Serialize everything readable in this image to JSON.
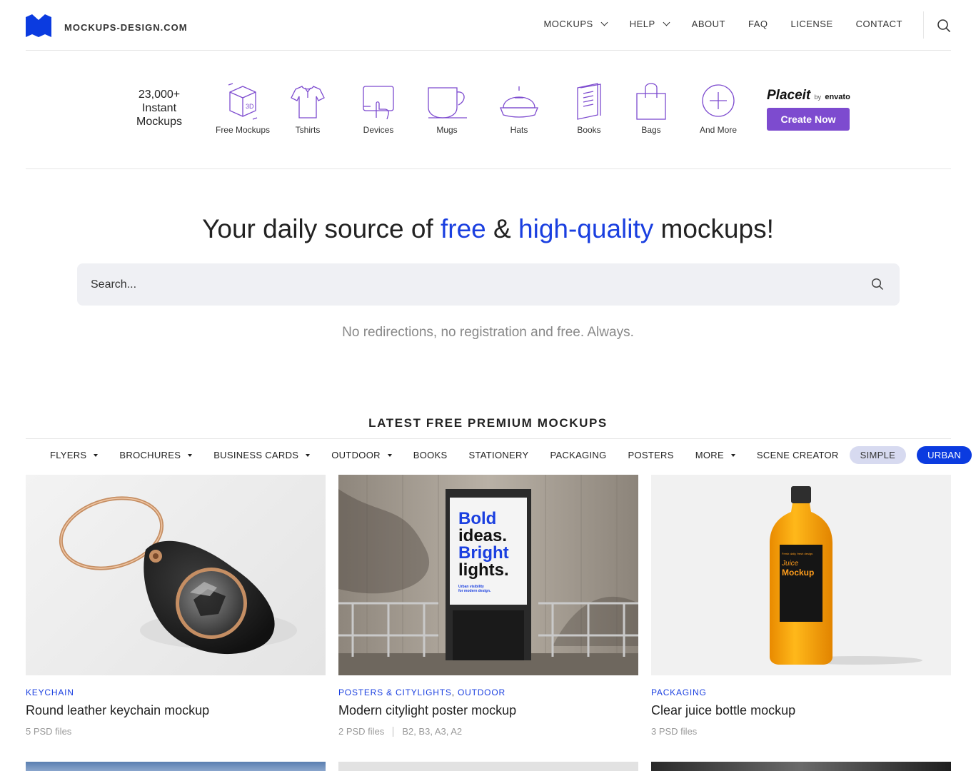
{
  "header": {
    "brand": "MOCKUPS-DESIGN.COM",
    "nav": [
      {
        "label": "MOCKUPS",
        "dropdown": true
      },
      {
        "label": "HELP",
        "dropdown": true
      },
      {
        "label": "ABOUT",
        "dropdown": false
      },
      {
        "label": "FAQ",
        "dropdown": false
      },
      {
        "label": "LICENSE",
        "dropdown": false
      },
      {
        "label": "CONTACT",
        "dropdown": false
      }
    ],
    "search_icon": "search-icon"
  },
  "categories": {
    "headline_line1": "23,000+",
    "headline_line2": "Instant",
    "headline_line3": "Mockups",
    "items": [
      {
        "label": "Free Mockups",
        "icon": "3d-box-icon"
      },
      {
        "label": "Tshirts",
        "icon": "tshirt-icon"
      },
      {
        "label": "Devices",
        "icon": "devices-icon"
      },
      {
        "label": "Mugs",
        "icon": "mug-icon"
      },
      {
        "label": "Hats",
        "icon": "hat-icon"
      },
      {
        "label": "Books",
        "icon": "book-icon"
      },
      {
        "label": "Bags",
        "icon": "bag-icon"
      },
      {
        "label": "And More",
        "icon": "plus-circle-icon"
      }
    ],
    "placeit": {
      "name": "Placeit",
      "by": "by",
      "partner": "envato",
      "cta": "Create Now"
    },
    "icon_color": "#7d4bcf"
  },
  "hero": {
    "title_part1": "Your daily source of ",
    "title_free": "free",
    "title_amp": " & ",
    "title_hq": "high-quality",
    "title_part2": " mockups!",
    "search_placeholder": "Search...",
    "tagline": "No redirections, no registration and free. Always.",
    "accent": "#1a3fe0"
  },
  "latest": {
    "title": "LATEST FREE PREMIUM MOCKUPS",
    "filters": [
      {
        "label": "FLYERS",
        "dropdown": true
      },
      {
        "label": "BROCHURES",
        "dropdown": true
      },
      {
        "label": "BUSINESS CARDS",
        "dropdown": true
      },
      {
        "label": "OUTDOOR",
        "dropdown": true
      },
      {
        "label": "BOOKS",
        "dropdown": false
      },
      {
        "label": "STATIONERY",
        "dropdown": false
      },
      {
        "label": "PACKAGING",
        "dropdown": false
      },
      {
        "label": "POSTERS",
        "dropdown": false
      },
      {
        "label": "MORE",
        "dropdown": true
      },
      {
        "label": "SCENE CREATOR",
        "dropdown": false
      }
    ],
    "pills": [
      {
        "label": "SIMPLE",
        "active": false
      },
      {
        "label": "URBAN",
        "active": true
      }
    ]
  },
  "cards": [
    {
      "tags": [
        "KEYCHAIN"
      ],
      "title": "Round leather keychain mockup",
      "meta": [
        "5 PSD files"
      ]
    },
    {
      "tags": [
        "POSTERS & CITYLIGHTS",
        "OUTDOOR"
      ],
      "title": "Modern citylight poster mockup",
      "meta": [
        "2 PSD files",
        "B2, B3, A3, A2"
      ],
      "poster_text": [
        "Bold",
        "ideas.",
        "Bright",
        "lights."
      ],
      "poster_small": [
        "Urban visibility",
        "for modern design."
      ]
    },
    {
      "tags": [
        "PACKAGING"
      ],
      "title": "Clear juice bottle mockup",
      "meta": [
        "3 PSD files"
      ],
      "label_top": "Fresh daily, fresh design.",
      "label_script": "Juice",
      "label_main": "Mockup"
    }
  ]
}
